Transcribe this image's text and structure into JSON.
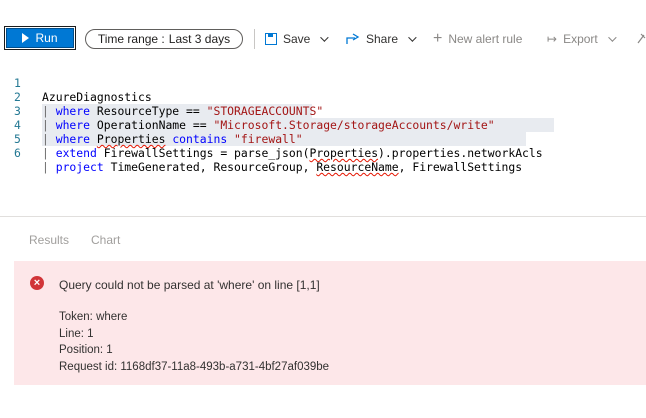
{
  "toolbar": {
    "run_label": "Run",
    "time_range_label": "Time range :",
    "time_range_value": "Last 3 days",
    "save_label": "Save",
    "share_label": "Share",
    "new_alert_label": "New alert rule",
    "export_label": "Export"
  },
  "editor": {
    "lines": [
      {
        "number": "1",
        "text": "AzureDiagnostics"
      },
      {
        "number": "2",
        "text": "| where ResourceType == \"STORAGEACCOUNTS\""
      },
      {
        "number": "3",
        "text": "| where OperationName == \"Microsoft.Storage/storageAccounts/write\""
      },
      {
        "number": "4",
        "text": "| where Properties contains \"firewall\""
      },
      {
        "number": "5",
        "text": "| extend FirewallSettings = parse_json(Properties).properties.networkAcls"
      },
      {
        "number": "6",
        "text": "| project TimeGenerated, ResourceGroup, ResourceName, FirewallSettings"
      }
    ]
  },
  "results": {
    "tabs": [
      "Results",
      "Chart"
    ]
  },
  "error": {
    "title": "Query could not be parsed at 'where' on line [1,1]",
    "token": "Token: where",
    "line": "Line: 1",
    "position": "Position: 1",
    "request_id": "Request id: 1168df37-11a8-493b-a731-4bf27af039be"
  },
  "colors": {
    "accent": "#0078d4",
    "error_bg": "#fde7e9",
    "error_icon": "#d13438"
  },
  "icons": [
    "play-icon",
    "save-icon",
    "share-icon",
    "plus-icon",
    "export-icon",
    "error-icon",
    "pin-icon"
  ]
}
